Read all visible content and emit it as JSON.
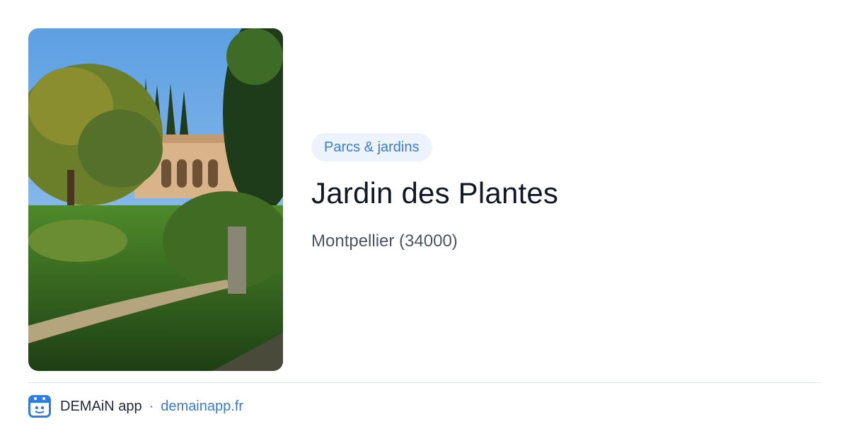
{
  "place": {
    "category": "Parcs & jardins",
    "name": "Jardin des Plantes",
    "location": "Montpellier (34000)",
    "photo_icon": "garden-photo"
  },
  "footer": {
    "app_name": "DEMAiN app",
    "separator": "·",
    "site": "demainapp.fr",
    "logo_icon": "demain-app-logo-icon"
  },
  "colors": {
    "badge_bg": "#edf3fd",
    "badge_text": "#3b7ad8",
    "title_text": "#111827",
    "subtitle_text": "#4a5563",
    "divider": "#dfe4ea",
    "footer_text": "#1f2937",
    "link": "#3b7ad8",
    "logo_bg": "#2f7de1"
  }
}
